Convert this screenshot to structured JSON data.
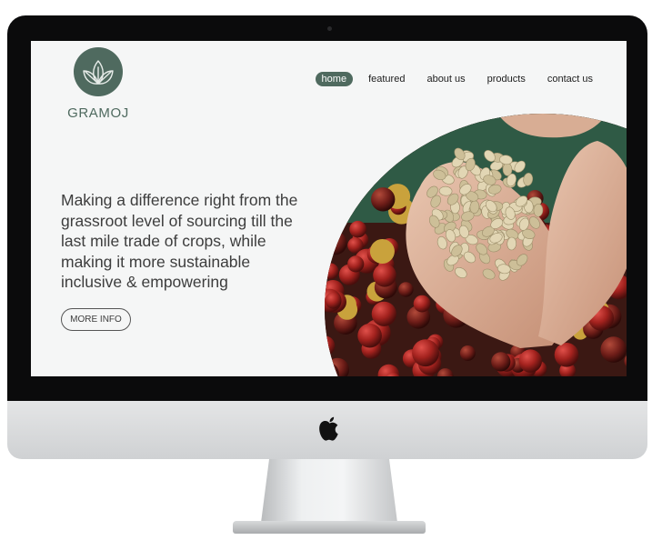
{
  "site": {
    "brand": "GRAMOJ",
    "logo": {
      "icon": "lotus-leaf-icon",
      "color": "#4f6a5f"
    }
  },
  "nav": {
    "items": [
      {
        "label": "home",
        "active": true
      },
      {
        "label": "featured",
        "active": false
      },
      {
        "label": "about us",
        "active": false
      },
      {
        "label": "products",
        "active": false
      },
      {
        "label": "contact us",
        "active": false
      }
    ]
  },
  "hero": {
    "headline": "Making a difference right from the grassroot level of sourcing till the last mile trade of crops, while making it more sustainable inclusive & empowering",
    "cta_label": "MORE INFO",
    "image": "hands-holding-green-coffee-beans-over-red-coffee-cherries"
  },
  "colors": {
    "accent": "#4f6a5f",
    "background": "#f5f6f6",
    "text": "#3d3d3d"
  },
  "device": {
    "icons": [
      "apple-logo-icon",
      "camera-icon"
    ]
  }
}
